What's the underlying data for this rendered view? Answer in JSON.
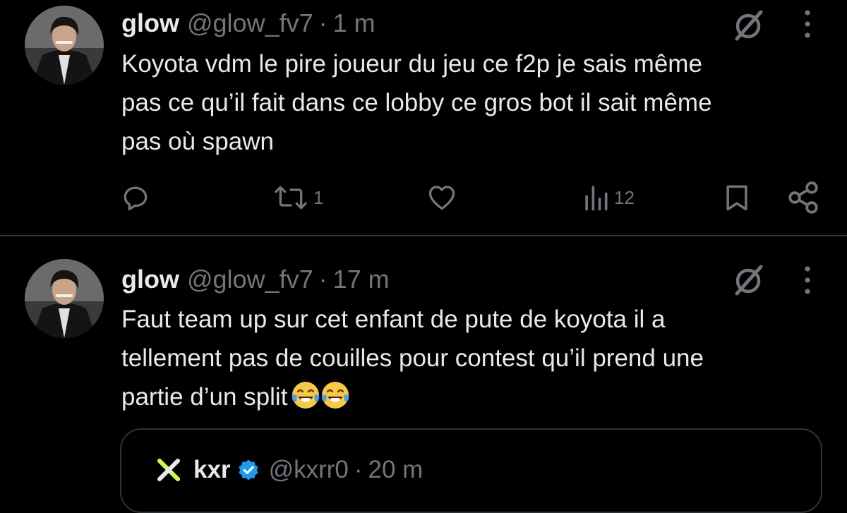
{
  "tweets": [
    {
      "name": "glow",
      "handle": "@glow_fv7",
      "separator": "·",
      "time": "1 m",
      "text": "Koyota vdm le pire joueur du jeu ce f2p je sais même\npas ce qu’il fait dans ce lobby ce gros bot il sait même\npas où spawn",
      "actions": {
        "reply_count": "",
        "repost_count": "1",
        "like_count": "",
        "views_count": "12"
      }
    },
    {
      "name": "glow",
      "handle": "@glow_fv7",
      "separator": "·",
      "time": "17 m",
      "text": "Faut team up sur cet enfant de pute de koyota il a\ntellement pas de couilles pour contest qu’il prend une\npartie d’un split",
      "emojis": [
        "face-with-tears-of-joy-icon",
        "face-with-tears-of-joy-icon"
      ],
      "quote": {
        "name": "kxr",
        "handle": "@kxrr0",
        "separator": "·",
        "time": "20 m",
        "verified": true
      }
    }
  ],
  "colors": {
    "background": "#000000",
    "primary_text": "#e7e9ea",
    "secondary_text": "#71767b",
    "divider": "#2f3336",
    "verified_badge": "#1d9bf0"
  },
  "icons": {
    "reply": "reply-icon",
    "repost": "repost-icon",
    "like": "heart-icon",
    "views": "views-chart-icon",
    "bookmark": "bookmark-icon",
    "share": "share-icon",
    "grok": "grok-icon",
    "more": "more-options-icon"
  }
}
